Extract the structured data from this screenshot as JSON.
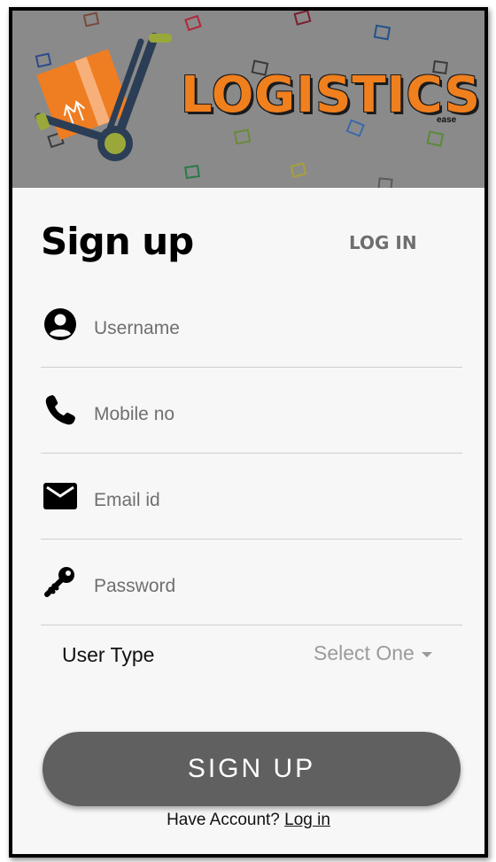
{
  "banner": {
    "logo_word": "LOGISTICS",
    "logo_sub": "ease"
  },
  "header": {
    "title": "Sign up",
    "login_tab": "LOG IN"
  },
  "form": {
    "username_placeholder": "Username",
    "mobile_placeholder": "Mobile no",
    "email_placeholder": "Email id",
    "password_placeholder": "Password",
    "user_type_label": "User Type",
    "user_type_selected": "Select One"
  },
  "actions": {
    "signup_label": "SIGN UP",
    "have_account_text": "Have Account?",
    "login_link": "Log in"
  },
  "colors": {
    "banner_bg": "#8a8a8a",
    "logo_orange": "#f07f1e",
    "button_bg": "#606060",
    "page_bg": "#f7f7f7"
  },
  "icons": [
    "account-circle-icon",
    "phone-icon",
    "mail-icon",
    "key-icon",
    "dropdown-caret-icon"
  ]
}
